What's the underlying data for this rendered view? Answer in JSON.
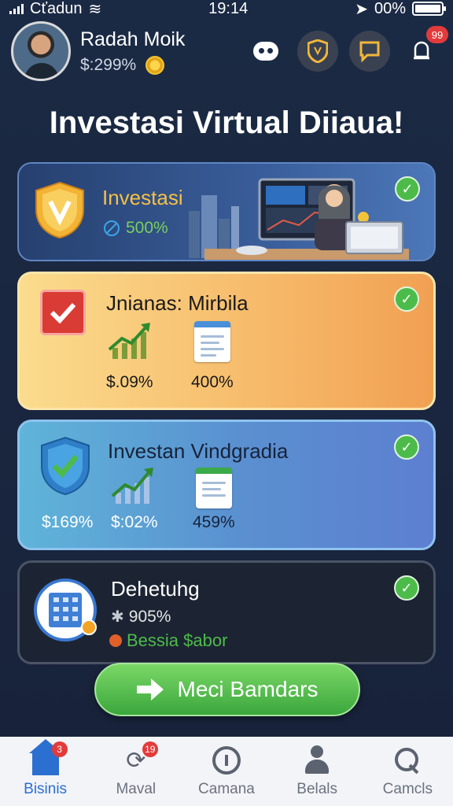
{
  "status_bar": {
    "carrier": "Cťadun",
    "time": "19:14",
    "battery": "00%",
    "battery_level": 0.9
  },
  "header": {
    "user_name": "Radah Moik",
    "balance": "$:299%",
    "notification_badge": "99",
    "icons": [
      "ghost-icon",
      "shield-icon",
      "chat-icon",
      "bell-icon"
    ]
  },
  "page_title": "Investasi Virtual Diiaua!",
  "cards": [
    {
      "title": "Investasi",
      "stat": "500%",
      "icon": "gold-shield-icon",
      "checked": true
    },
    {
      "title": "Jnianas: Mirbila",
      "stats": [
        "$.09%",
        "400%"
      ],
      "icon": "checkbox-icon",
      "checked": true
    },
    {
      "title": "Investan Vindgradia",
      "stats": [
        "$169%",
        "$:02%",
        "459%"
      ],
      "icon": "blue-shield-icon",
      "checked": true
    },
    {
      "title": "Dehetuhg",
      "stat1": "905%",
      "stat2": "Bessia $abor",
      "icon": "building-icon",
      "checked": true
    }
  ],
  "cta": {
    "label": "Meci Bamdars"
  },
  "nav": {
    "items": [
      {
        "label": "Bisinis",
        "badge": "3",
        "icon": "home-icon"
      },
      {
        "label": "Maval",
        "badge": "19",
        "icon": "refresh-icon"
      },
      {
        "label": "Camana",
        "badge": "",
        "icon": "info-ring-icon"
      },
      {
        "label": "Belals",
        "badge": "",
        "icon": "person-icon"
      },
      {
        "label": "Camcls",
        "badge": "",
        "icon": "search-icon"
      }
    ]
  },
  "colors": {
    "accent": "#2b6fd1",
    "check": "#4cbb4a",
    "cta": "#4cb445",
    "gold": "#f6c043"
  }
}
